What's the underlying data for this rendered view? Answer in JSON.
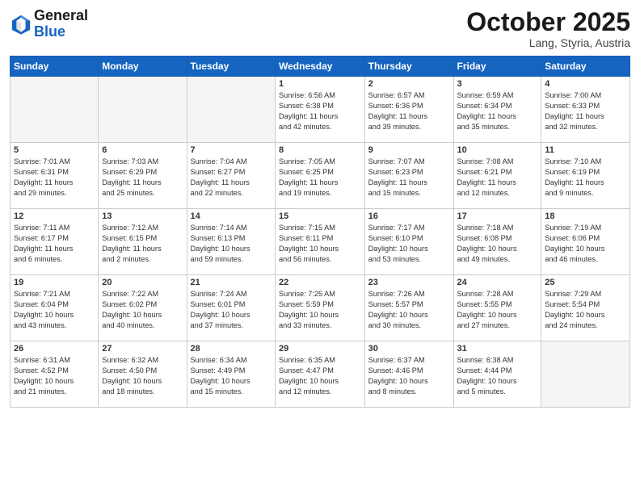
{
  "header": {
    "logo": {
      "general": "General",
      "blue": "Blue"
    },
    "month": "October 2025",
    "location": "Lang, Styria, Austria"
  },
  "weekdays": [
    "Sunday",
    "Monday",
    "Tuesday",
    "Wednesday",
    "Thursday",
    "Friday",
    "Saturday"
  ],
  "weeks": [
    [
      {
        "day": "",
        "info": ""
      },
      {
        "day": "",
        "info": ""
      },
      {
        "day": "",
        "info": ""
      },
      {
        "day": "1",
        "info": "Sunrise: 6:56 AM\nSunset: 6:38 PM\nDaylight: 11 hours\nand 42 minutes."
      },
      {
        "day": "2",
        "info": "Sunrise: 6:57 AM\nSunset: 6:36 PM\nDaylight: 11 hours\nand 39 minutes."
      },
      {
        "day": "3",
        "info": "Sunrise: 6:59 AM\nSunset: 6:34 PM\nDaylight: 11 hours\nand 35 minutes."
      },
      {
        "day": "4",
        "info": "Sunrise: 7:00 AM\nSunset: 6:33 PM\nDaylight: 11 hours\nand 32 minutes."
      }
    ],
    [
      {
        "day": "5",
        "info": "Sunrise: 7:01 AM\nSunset: 6:31 PM\nDaylight: 11 hours\nand 29 minutes."
      },
      {
        "day": "6",
        "info": "Sunrise: 7:03 AM\nSunset: 6:29 PM\nDaylight: 11 hours\nand 25 minutes."
      },
      {
        "day": "7",
        "info": "Sunrise: 7:04 AM\nSunset: 6:27 PM\nDaylight: 11 hours\nand 22 minutes."
      },
      {
        "day": "8",
        "info": "Sunrise: 7:05 AM\nSunset: 6:25 PM\nDaylight: 11 hours\nand 19 minutes."
      },
      {
        "day": "9",
        "info": "Sunrise: 7:07 AM\nSunset: 6:23 PM\nDaylight: 11 hours\nand 15 minutes."
      },
      {
        "day": "10",
        "info": "Sunrise: 7:08 AM\nSunset: 6:21 PM\nDaylight: 11 hours\nand 12 minutes."
      },
      {
        "day": "11",
        "info": "Sunrise: 7:10 AM\nSunset: 6:19 PM\nDaylight: 11 hours\nand 9 minutes."
      }
    ],
    [
      {
        "day": "12",
        "info": "Sunrise: 7:11 AM\nSunset: 6:17 PM\nDaylight: 11 hours\nand 6 minutes."
      },
      {
        "day": "13",
        "info": "Sunrise: 7:12 AM\nSunset: 6:15 PM\nDaylight: 11 hours\nand 2 minutes."
      },
      {
        "day": "14",
        "info": "Sunrise: 7:14 AM\nSunset: 6:13 PM\nDaylight: 10 hours\nand 59 minutes."
      },
      {
        "day": "15",
        "info": "Sunrise: 7:15 AM\nSunset: 6:11 PM\nDaylight: 10 hours\nand 56 minutes."
      },
      {
        "day": "16",
        "info": "Sunrise: 7:17 AM\nSunset: 6:10 PM\nDaylight: 10 hours\nand 53 minutes."
      },
      {
        "day": "17",
        "info": "Sunrise: 7:18 AM\nSunset: 6:08 PM\nDaylight: 10 hours\nand 49 minutes."
      },
      {
        "day": "18",
        "info": "Sunrise: 7:19 AM\nSunset: 6:06 PM\nDaylight: 10 hours\nand 46 minutes."
      }
    ],
    [
      {
        "day": "19",
        "info": "Sunrise: 7:21 AM\nSunset: 6:04 PM\nDaylight: 10 hours\nand 43 minutes."
      },
      {
        "day": "20",
        "info": "Sunrise: 7:22 AM\nSunset: 6:02 PM\nDaylight: 10 hours\nand 40 minutes."
      },
      {
        "day": "21",
        "info": "Sunrise: 7:24 AM\nSunset: 6:01 PM\nDaylight: 10 hours\nand 37 minutes."
      },
      {
        "day": "22",
        "info": "Sunrise: 7:25 AM\nSunset: 5:59 PM\nDaylight: 10 hours\nand 33 minutes."
      },
      {
        "day": "23",
        "info": "Sunrise: 7:26 AM\nSunset: 5:57 PM\nDaylight: 10 hours\nand 30 minutes."
      },
      {
        "day": "24",
        "info": "Sunrise: 7:28 AM\nSunset: 5:55 PM\nDaylight: 10 hours\nand 27 minutes."
      },
      {
        "day": "25",
        "info": "Sunrise: 7:29 AM\nSunset: 5:54 PM\nDaylight: 10 hours\nand 24 minutes."
      }
    ],
    [
      {
        "day": "26",
        "info": "Sunrise: 6:31 AM\nSunset: 4:52 PM\nDaylight: 10 hours\nand 21 minutes."
      },
      {
        "day": "27",
        "info": "Sunrise: 6:32 AM\nSunset: 4:50 PM\nDaylight: 10 hours\nand 18 minutes."
      },
      {
        "day": "28",
        "info": "Sunrise: 6:34 AM\nSunset: 4:49 PM\nDaylight: 10 hours\nand 15 minutes."
      },
      {
        "day": "29",
        "info": "Sunrise: 6:35 AM\nSunset: 4:47 PM\nDaylight: 10 hours\nand 12 minutes."
      },
      {
        "day": "30",
        "info": "Sunrise: 6:37 AM\nSunset: 4:46 PM\nDaylight: 10 hours\nand 8 minutes."
      },
      {
        "day": "31",
        "info": "Sunrise: 6:38 AM\nSunset: 4:44 PM\nDaylight: 10 hours\nand 5 minutes."
      },
      {
        "day": "",
        "info": ""
      }
    ]
  ]
}
